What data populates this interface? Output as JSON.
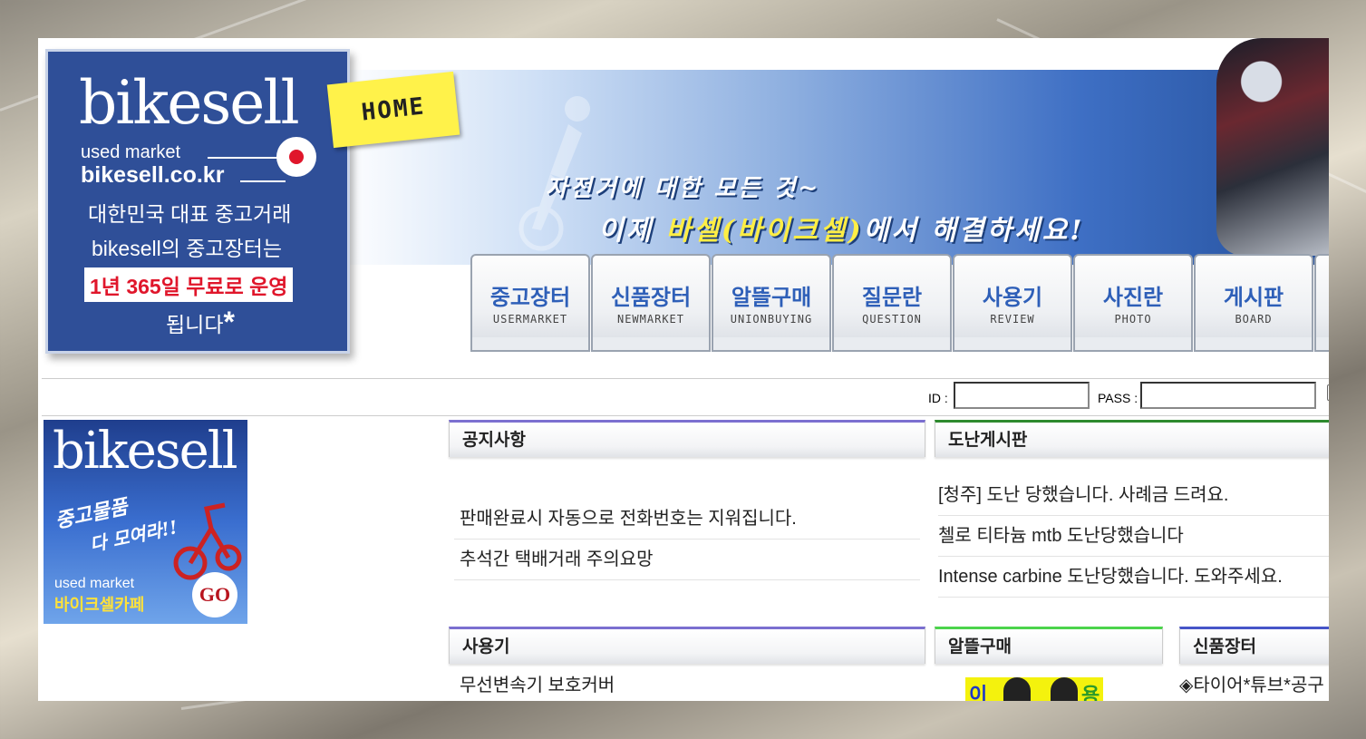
{
  "logo": {
    "wordmark": "bikesell",
    "sub_text": "used market",
    "domain": "bikesell.co.kr",
    "tagline_line1": "대한민국 대표 중고거래",
    "tagline_line2": "bikesell의 중고장터는",
    "highlight": "1년 365일 무료로 운영",
    "tagline_line3": "됩니다",
    "asterisk": "*"
  },
  "home_tag": "HOME",
  "slogan": {
    "line1": "자전거에 대한 모든 것~",
    "line2_prefix": "이제",
    "line2_highlight": "바셀(바이크셀)",
    "line2_suffix": "에서 해결하세요!"
  },
  "nav": {
    "tabs": [
      {
        "kr": "중고장터",
        "en": "USERMARKET"
      },
      {
        "kr": "신품장터",
        "en": "NEWMARKET"
      },
      {
        "kr": "알뜰구매",
        "en": "UNIONBUYING"
      },
      {
        "kr": "질문란",
        "en": "QUESTION"
      },
      {
        "kr": "사용기",
        "en": "REVIEW"
      },
      {
        "kr": "사진란",
        "en": "PHOTO"
      },
      {
        "kr": "게시판",
        "en": "BOARD"
      }
    ]
  },
  "login": {
    "id_label": "ID :",
    "id_value": "",
    "pass_label": "PASS :",
    "pass_value": ""
  },
  "side_banner": {
    "wordmark": "bikesell",
    "kr_line1": "중고물품",
    "kr_line2": "다 모여라!!",
    "used": "used market",
    "cafe": "바이크셀카페",
    "go": "GO"
  },
  "notice": {
    "title": "공지사항",
    "items": [
      "판매완료시 자동으로 전화번호는 지워집니다.",
      "추석간 택배거래 주의요망"
    ]
  },
  "theft": {
    "title": "도난게시판",
    "items": [
      "[청주] 도난 당했습니다. 사례금 드려요.",
      "첼로 티타늄 mtb 도난당했습니다",
      "Intense carbine 도난당했습니다. 도와주세요."
    ]
  },
  "review": {
    "title": "사용기",
    "items": [
      "무선변속기 보호커버"
    ]
  },
  "union": {
    "title": "알뜰구매",
    "badge_left": "이",
    "badge_right": "용"
  },
  "newmarket": {
    "title": "신품장터",
    "items": [
      "◈타이어*튜브*공구"
    ]
  }
}
